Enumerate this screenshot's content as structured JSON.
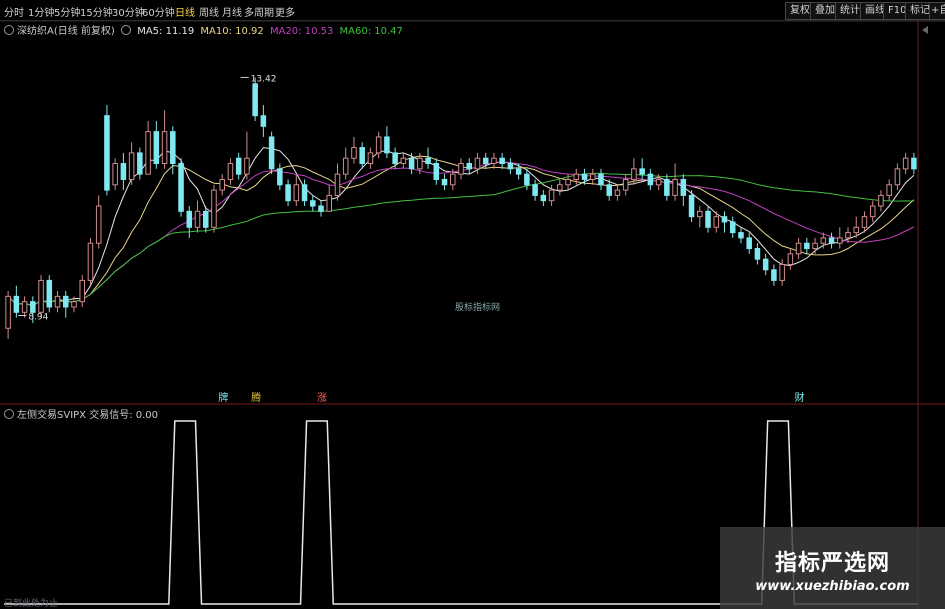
{
  "toolbar": {
    "periods": [
      "分时",
      "1分钟",
      "5分钟",
      "15分钟",
      "30分钟",
      "60分钟",
      "日线",
      "周线",
      "月线",
      "多周期",
      "更多"
    ],
    "active_period": "日线",
    "right_buttons": [
      "复权",
      "叠加",
      "统计",
      "画线",
      "F10",
      "标记",
      "+自选"
    ]
  },
  "legend_main": {
    "name": "深纺织A(日线 前复权)",
    "ma": [
      {
        "label": "MA5: 11.19",
        "color": "#e6e6e6"
      },
      {
        "label": "MA10: 10.92",
        "color": "#e8d48a"
      },
      {
        "label": "MA20: 10.53",
        "color": "#c040c0"
      },
      {
        "label": "MA60: 10.47",
        "color": "#40c040"
      }
    ]
  },
  "legend_sub": {
    "text": "左侧交易SVIPX 交易信号: 0.00"
  },
  "center_watermark": "股标指标网",
  "status_text": "已到此处为止",
  "watermark": {
    "cn": "指标严选网",
    "url": "www.xuezhibiao.com"
  },
  "colors": {
    "up": "#d08a8a",
    "down": "#7fe8f0",
    "ma5": "#e6e6e6",
    "ma10": "#e8d48a",
    "ma20": "#c040c0",
    "ma60": "#40c040",
    "signal": "#e8e8e8",
    "grid": "#3a1010"
  },
  "chart_data": {
    "type": "candlestick",
    "price_range": [
      7.5,
      14.2
    ],
    "annotations": [
      {
        "text": "13.42",
        "value": 13.42,
        "index": 28
      },
      {
        "text": "8.94",
        "value": 8.94,
        "index": 1
      }
    ],
    "signals": [
      {
        "text": "牌",
        "index": 26,
        "color": "#7fe8f0"
      },
      {
        "text": "腾",
        "index": 30,
        "color": "#e8c040"
      },
      {
        "text": "涨",
        "index": 38,
        "color": "#ff6060"
      },
      {
        "text": "财",
        "index": 96,
        "color": "#7fe8f0"
      }
    ],
    "candles": [
      [
        8.7,
        9.3,
        9.4,
        8.5
      ],
      [
        9.3,
        9.0,
        9.5,
        8.9
      ],
      [
        9.0,
        9.2,
        9.3,
        8.9
      ],
      [
        9.2,
        9.0,
        9.3,
        8.8
      ],
      [
        9.0,
        9.6,
        9.7,
        8.9
      ],
      [
        9.6,
        9.1,
        9.7,
        9.0
      ],
      [
        9.1,
        9.3,
        9.4,
        9.0
      ],
      [
        9.3,
        9.1,
        9.4,
        8.9
      ],
      [
        9.1,
        9.2,
        9.3,
        9.0
      ],
      [
        9.2,
        9.6,
        9.7,
        9.1
      ],
      [
        9.6,
        10.3,
        10.4,
        9.5
      ],
      [
        10.3,
        11.0,
        11.2,
        10.2
      ],
      [
        12.7,
        11.3,
        12.9,
        11.2
      ],
      [
        11.4,
        11.8,
        11.9,
        11.3
      ],
      [
        11.8,
        11.5,
        12.0,
        11.3
      ],
      [
        11.5,
        12.0,
        12.2,
        11.4
      ],
      [
        12.0,
        11.6,
        12.1,
        11.5
      ],
      [
        11.6,
        12.4,
        12.6,
        11.6
      ],
      [
        12.4,
        11.8,
        12.6,
        11.7
      ],
      [
        11.8,
        12.4,
        12.8,
        11.7
      ],
      [
        12.4,
        11.8,
        12.5,
        11.6
      ],
      [
        11.8,
        10.9,
        11.9,
        10.8
      ],
      [
        10.9,
        10.6,
        11.0,
        10.4
      ],
      [
        10.6,
        10.9,
        11.1,
        10.5
      ],
      [
        10.9,
        10.6,
        11.0,
        10.5
      ],
      [
        10.6,
        11.3,
        11.4,
        10.5
      ],
      [
        11.3,
        11.5,
        11.6,
        11.2
      ],
      [
        11.5,
        11.8,
        11.9,
        11.4
      ],
      [
        11.9,
        11.6,
        12.0,
        11.5
      ],
      [
        11.6,
        11.9,
        12.4,
        11.5
      ],
      [
        13.3,
        12.7,
        13.42,
        12.6
      ],
      [
        12.7,
        12.5,
        12.9,
        12.3
      ],
      [
        12.3,
        11.7,
        12.4,
        11.6
      ],
      [
        11.7,
        11.4,
        11.8,
        11.3
      ],
      [
        11.4,
        11.1,
        11.5,
        11.0
      ],
      [
        11.1,
        11.4,
        11.6,
        11.0
      ],
      [
        11.4,
        11.1,
        11.5,
        11.0
      ],
      [
        11.1,
        11.0,
        11.2,
        10.9
      ],
      [
        11.0,
        10.9,
        11.1,
        10.8
      ],
      [
        10.9,
        11.2,
        11.4,
        10.9
      ],
      [
        11.2,
        11.6,
        11.8,
        11.1
      ],
      [
        11.6,
        11.9,
        12.1,
        11.5
      ],
      [
        11.9,
        12.1,
        12.3,
        11.8
      ],
      [
        12.1,
        11.8,
        12.2,
        11.7
      ],
      [
        11.8,
        12.0,
        12.1,
        11.7
      ],
      [
        12.0,
        12.3,
        12.4,
        11.9
      ],
      [
        12.3,
        12.0,
        12.5,
        11.9
      ],
      [
        12.0,
        11.8,
        12.1,
        11.7
      ],
      [
        11.8,
        11.9,
        12.0,
        11.7
      ],
      [
        11.9,
        11.7,
        12.0,
        11.6
      ],
      [
        11.7,
        11.9,
        12.0,
        11.6
      ],
      [
        11.9,
        11.8,
        12.1,
        11.7
      ],
      [
        11.8,
        11.5,
        11.9,
        11.4
      ],
      [
        11.5,
        11.4,
        11.6,
        11.3
      ],
      [
        11.4,
        11.6,
        11.7,
        11.3
      ],
      [
        11.6,
        11.8,
        11.9,
        11.5
      ],
      [
        11.8,
        11.7,
        11.9,
        11.6
      ],
      [
        11.7,
        11.9,
        12.0,
        11.6
      ],
      [
        11.9,
        11.8,
        12.0,
        11.7
      ],
      [
        11.8,
        11.9,
        12.0,
        11.7
      ],
      [
        11.9,
        11.8,
        12.0,
        11.7
      ],
      [
        11.8,
        11.7,
        11.9,
        11.6
      ],
      [
        11.7,
        11.6,
        11.8,
        11.5
      ],
      [
        11.6,
        11.4,
        11.7,
        11.3
      ],
      [
        11.4,
        11.2,
        11.5,
        11.1
      ],
      [
        11.2,
        11.1,
        11.3,
        11.0
      ],
      [
        11.1,
        11.3,
        11.4,
        11.0
      ],
      [
        11.3,
        11.4,
        11.5,
        11.2
      ],
      [
        11.4,
        11.5,
        11.6,
        11.3
      ],
      [
        11.5,
        11.6,
        11.7,
        11.4
      ],
      [
        11.6,
        11.5,
        11.7,
        11.4
      ],
      [
        11.5,
        11.6,
        11.7,
        11.4
      ],
      [
        11.6,
        11.4,
        11.7,
        11.3
      ],
      [
        11.4,
        11.2,
        11.5,
        11.1
      ],
      [
        11.2,
        11.3,
        11.4,
        11.1
      ],
      [
        11.3,
        11.5,
        11.6,
        11.2
      ],
      [
        11.5,
        11.7,
        11.9,
        11.4
      ],
      [
        11.7,
        11.6,
        11.9,
        11.5
      ],
      [
        11.6,
        11.4,
        11.7,
        11.3
      ],
      [
        11.4,
        11.5,
        11.6,
        11.3
      ],
      [
        11.5,
        11.2,
        11.6,
        11.1
      ],
      [
        11.2,
        11.5,
        11.8,
        11.1
      ],
      [
        11.5,
        11.2,
        11.6,
        11.0
      ],
      [
        11.2,
        10.8,
        11.3,
        10.7
      ],
      [
        10.8,
        10.9,
        11.0,
        10.6
      ],
      [
        10.9,
        10.6,
        11.0,
        10.5
      ],
      [
        10.6,
        10.8,
        10.9,
        10.5
      ],
      [
        10.8,
        10.7,
        10.9,
        10.5
      ],
      [
        10.7,
        10.5,
        10.8,
        10.4
      ],
      [
        10.5,
        10.4,
        10.6,
        10.3
      ],
      [
        10.4,
        10.2,
        10.5,
        10.1
      ],
      [
        10.2,
        10.0,
        10.3,
        9.9
      ],
      [
        10.0,
        9.8,
        10.1,
        9.7
      ],
      [
        9.8,
        9.6,
        9.9,
        9.5
      ],
      [
        9.6,
        9.9,
        10.0,
        9.5
      ],
      [
        9.9,
        10.1,
        10.2,
        9.8
      ],
      [
        10.1,
        10.3,
        10.4,
        10.0
      ],
      [
        10.3,
        10.2,
        10.4,
        10.1
      ],
      [
        10.2,
        10.3,
        10.4,
        10.1
      ],
      [
        10.3,
        10.4,
        10.5,
        10.2
      ],
      [
        10.4,
        10.3,
        10.5,
        10.2
      ],
      [
        10.3,
        10.4,
        10.6,
        10.2
      ],
      [
        10.4,
        10.5,
        10.6,
        10.3
      ],
      [
        10.5,
        10.6,
        10.8,
        10.4
      ],
      [
        10.6,
        10.8,
        10.9,
        10.5
      ],
      [
        10.8,
        11.0,
        11.1,
        10.7
      ],
      [
        11.0,
        11.2,
        11.3,
        10.9
      ],
      [
        11.2,
        11.4,
        11.5,
        11.1
      ],
      [
        11.4,
        11.7,
        11.8,
        11.3
      ],
      [
        11.7,
        11.9,
        12.0,
        11.6
      ],
      [
        11.9,
        11.7,
        12.0,
        11.6
      ]
    ],
    "signal_series": [
      0,
      0,
      0,
      0,
      0,
      0,
      0,
      0,
      0,
      0,
      0,
      0,
      0,
      0,
      0,
      0,
      0,
      0,
      0,
      0,
      0,
      0,
      0,
      0,
      0,
      0,
      0,
      0,
      0,
      0,
      0,
      0,
      0,
      0,
      0,
      0,
      0,
      0,
      0,
      0,
      0,
      0,
      0,
      0,
      0,
      0,
      0,
      0,
      0,
      0,
      0,
      0,
      0,
      0,
      0,
      0,
      0,
      0,
      0,
      0,
      0,
      0,
      0,
      0,
      0,
      0,
      0,
      0,
      0,
      0,
      0,
      0,
      0,
      0,
      0,
      0,
      0,
      0,
      0,
      0,
      0,
      0,
      0,
      0,
      0,
      0,
      0,
      0,
      0,
      0,
      0,
      0,
      0,
      0,
      0,
      0,
      0,
      0,
      0,
      0,
      0,
      0,
      0,
      0,
      0,
      0,
      0,
      0,
      0,
      0,
      0,
      0,
      0,
      0,
      0,
      0,
      0
    ],
    "signal_pulses": [
      {
        "start": 20,
        "end": 23
      },
      {
        "start": 36,
        "end": 39
      },
      {
        "start": 92,
        "end": 95
      }
    ]
  }
}
